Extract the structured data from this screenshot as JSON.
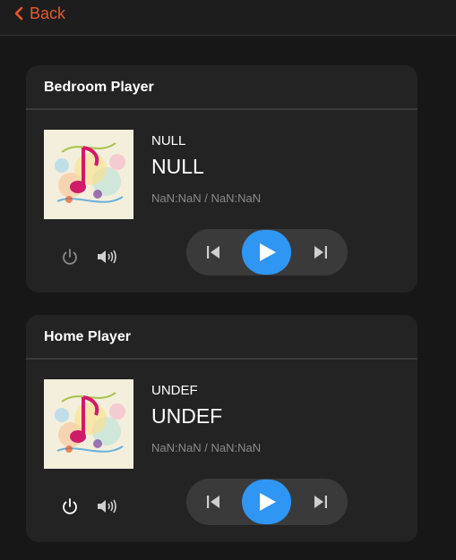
{
  "nav": {
    "back_label": "Back"
  },
  "colors": {
    "accent_back": "#e8582a",
    "play_button": "#2f96f3",
    "background": "#171717",
    "card": "#232323"
  },
  "players": [
    {
      "title": "Bedroom Player",
      "artist": "NULL",
      "track": "NULL",
      "time": "NaN:NaN / NaN:NaN",
      "power_state": "off"
    },
    {
      "title": "Home Player",
      "artist": "UNDEF",
      "track": "UNDEF",
      "time": "NaN:NaN / NaN:NaN",
      "power_state": "on"
    }
  ],
  "icons": {
    "back": "chevron-left-icon",
    "power": "power-icon",
    "volume": "volume-icon",
    "prev": "skip-previous-icon",
    "play": "play-icon",
    "next": "skip-next-icon"
  }
}
